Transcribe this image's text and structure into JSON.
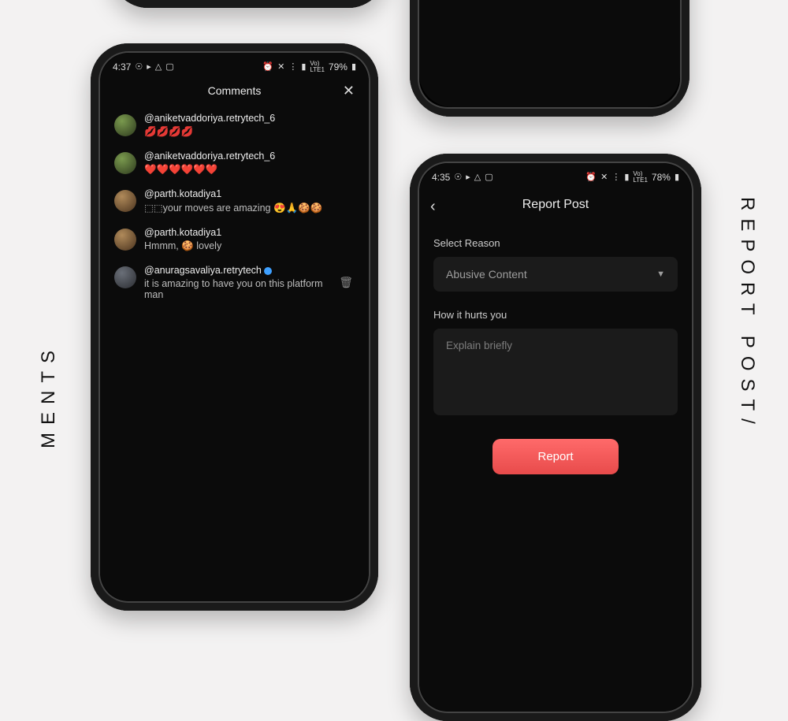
{
  "side_labels": {
    "left": "MENTS",
    "right": "REPORT POST/"
  },
  "comments_screen": {
    "status": {
      "time": "4:37",
      "battery": "79%"
    },
    "title": "Comments",
    "items": [
      {
        "user": "@aniketvaddoriya.retrytech_6",
        "text": "💋💋💋💋",
        "avatar": "a",
        "verified": false,
        "deletable": false
      },
      {
        "user": "@aniketvaddoriya.retrytech_6",
        "text": "❤️❤️❤️❤️❤️❤️",
        "avatar": "a",
        "verified": false,
        "deletable": false
      },
      {
        "user": "@parth.kotadiya1",
        "text": "⬚⬚your moves are amazing 😍🙏🍪🍪",
        "avatar": "b",
        "verified": false,
        "deletable": false
      },
      {
        "user": "@parth.kotadiya1",
        "text": "Hmmm, 🍪 lovely",
        "avatar": "b",
        "verified": false,
        "deletable": false
      },
      {
        "user": "@anuragsavaliya.retrytech",
        "text": "it is amazing to have you on this platform man",
        "avatar": "c",
        "verified": true,
        "deletable": true
      }
    ]
  },
  "report_screen": {
    "status": {
      "time": "4:35",
      "battery": "78%"
    },
    "title": "Report Post",
    "reason_label": "Select Reason",
    "reason_value": "Abusive Content",
    "howhurts_label": "How it hurts you",
    "howhurts_placeholder": "Explain briefly",
    "button": "Report"
  }
}
